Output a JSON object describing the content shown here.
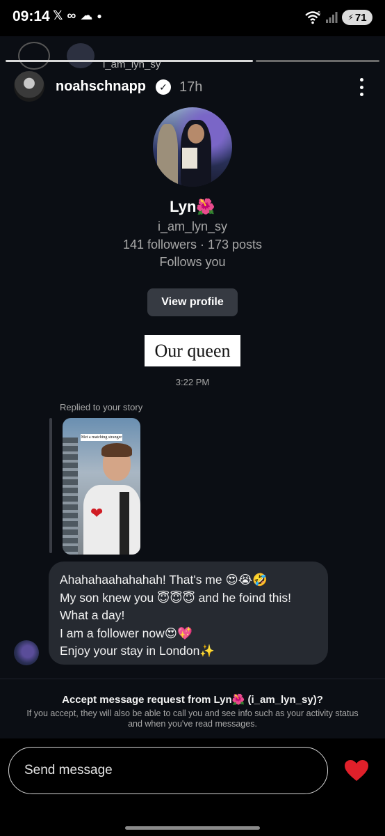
{
  "status_bar": {
    "time": "09:14",
    "left_icons": [
      "x-icon",
      "voicemail-icon",
      "cloud-icon",
      "dot-icon"
    ],
    "signal_label": "6",
    "battery": "71"
  },
  "story_strip": {
    "username": "i_am_lyn_sy"
  },
  "header": {
    "username": "noahschnapp",
    "time_ago": "17h"
  },
  "profile": {
    "name": "Lyn🌺",
    "handle": "i_am_lyn_sy",
    "stats": "141 followers · 173 posts",
    "follows": "Follows you",
    "view_profile_label": "View profile"
  },
  "shared_caption": "Our queen",
  "message_time": "3:22 PM",
  "reply": {
    "label": "Replied to your story",
    "story_caption": "Met a matching stranger"
  },
  "message": {
    "lines": [
      "Ahahahaahahahah! That's me 😍😭🤣",
      "My son knew you 😇😇😇 and he foind this!",
      "What a day!",
      "I am a follower now😍💖",
      "Enjoy your stay in London✨"
    ]
  },
  "request": {
    "title": "Accept message request from Lyn🌺 (i_am_lyn_sy)?",
    "description": "If you accept, they will also be able to call you and see info such as your activity status and when you've read messages."
  },
  "composer": {
    "placeholder": "Send message"
  },
  "colors": {
    "background": "#0b0e14",
    "bubble": "#262a31",
    "heart": "#e0202a",
    "muted": "#a8a8a8"
  }
}
